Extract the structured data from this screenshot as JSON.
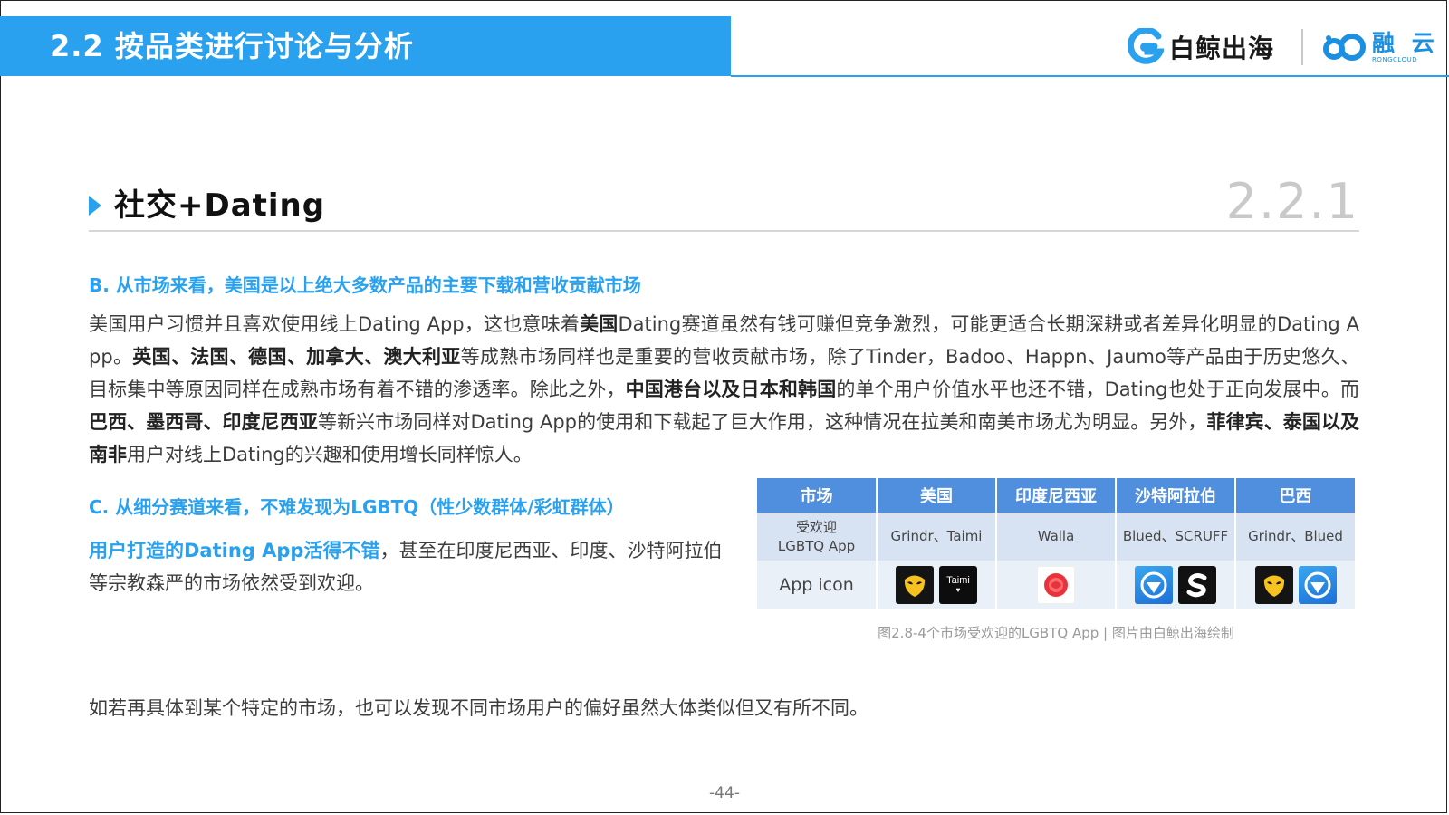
{
  "header": {
    "title": "2.2 按品类进行讨论与分析",
    "brand_left": "白鲸出海",
    "brand_right": "融 云",
    "brand_right_sub": "RONGCLOUD"
  },
  "section": {
    "title": "社交+Dating",
    "number": "2.2.1"
  },
  "part_b": {
    "heading": "B. 从市场来看，美国是以上绝大多数产品的主要下载和营收贡献市场",
    "segments": [
      {
        "t": "美国用户习惯并且喜欢使用线上Dating  App，这也意味着",
        "b": false
      },
      {
        "t": "美国",
        "b": true
      },
      {
        "t": "Dating赛道虽然有钱可赚但竞争激烈，可能更适合长期深耕或者差异化明显的Dating  App。",
        "b": false
      },
      {
        "t": "英国、法国、德国、加拿大、澳大利亚",
        "b": true
      },
      {
        "t": "等成熟市场同样也是重要的营收贡献市场，除了Tinder，Badoo、Happn、Jaumo等产品由于历史悠久、目标集中等原因同样在成熟市场有着不错的渗透率。除此之外，",
        "b": false
      },
      {
        "t": "中国港台以及日本和韩国",
        "b": true
      },
      {
        "t": "的单个用户价值水平也还不错，Dating也处于正向发展中。而",
        "b": false
      },
      {
        "t": "巴西、墨西哥、印度尼西亚",
        "b": true
      },
      {
        "t": "等新兴市场同样对Dating  App的使用和下载起了巨大作用，这种情况在拉美和南美市场尤为明显。另外，",
        "b": false
      },
      {
        "t": "菲律宾、泰国以及南非",
        "b": true
      },
      {
        "t": "用户对线上Dating的兴趣和使用增长同样惊人。",
        "b": false
      }
    ]
  },
  "part_c": {
    "heading": "C. 从细分赛道来看，不难发现为LGBTQ（性少数群体/彩虹群体）",
    "highlight": "用户打造的Dating App活得不错",
    "rest": "，甚至在印度尼西亚、印度、沙特阿拉伯等宗教森严的市场依然受到欢迎。"
  },
  "table": {
    "headers": [
      "市场",
      "美国",
      "印度尼西亚",
      "沙特阿拉伯",
      "巴西"
    ],
    "row_apps": {
      "label_line1": "受欢迎",
      "label_line2": "LGBTQ App",
      "cells": [
        "Grindr、Taimi",
        "Walla",
        "Blued、SCRUFF",
        "Grindr、Blued"
      ]
    },
    "row_icons": {
      "label": "App icon",
      "cells": [
        {
          "icons": [
            "grindr-icon",
            "taimi-icon"
          ]
        },
        {
          "icons": [
            "walla-icon"
          ]
        },
        {
          "icons": [
            "blued-icon",
            "scruff-icon"
          ]
        },
        {
          "icons": [
            "grindr-icon",
            "blued-icon"
          ]
        }
      ]
    },
    "taimi_icon_text": "Taimi",
    "colors": {
      "header_bg": "#4f8fdd",
      "row1_bg": "#d7e3f3",
      "row2_bg": "#eaf0f8"
    }
  },
  "caption": "图2.8-4个市场受欢迎的LGBTQ App | 图片由白鲸出海绘制",
  "final_text": "如若再具体到某个特定的市场，也可以发现不同市场用户的偏好虽然大体类似但又有所不同。",
  "page_number": "-44-",
  "colors": {
    "accent": "#2aa1ee",
    "section_number": "#c9c9c9"
  }
}
